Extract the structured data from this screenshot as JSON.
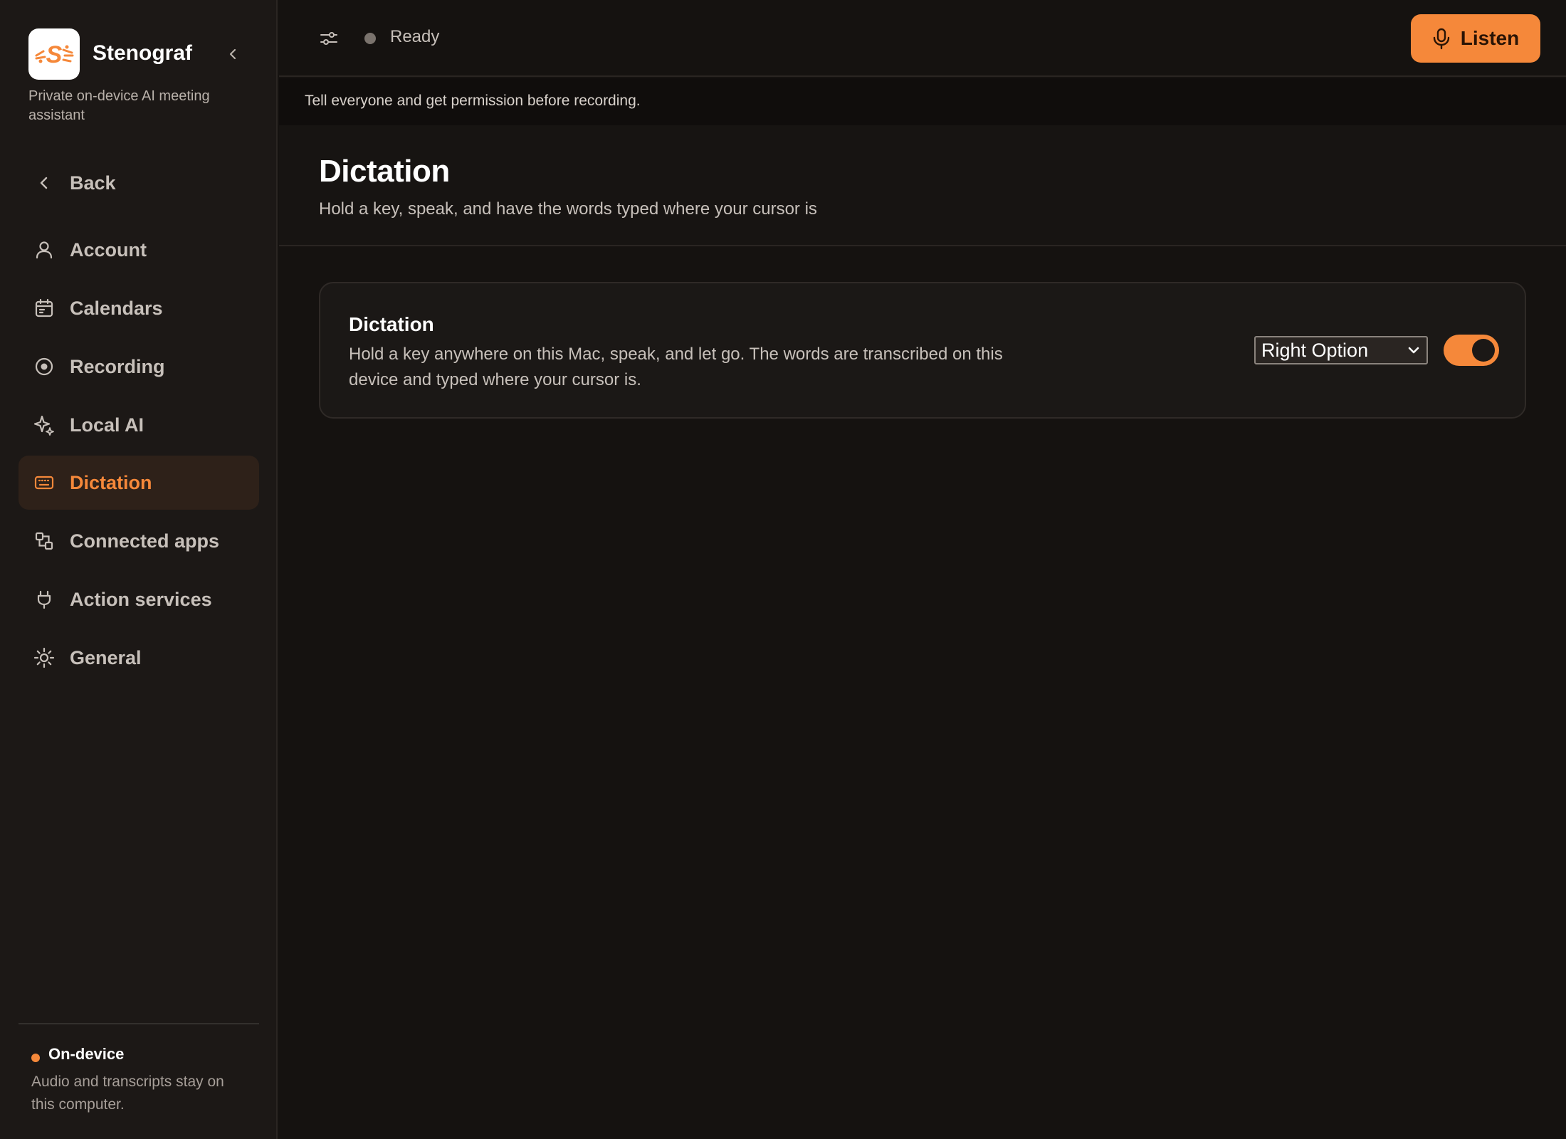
{
  "app": {
    "name": "Stenograf",
    "tagline": "Private on-device AI meeting assistant"
  },
  "sidebar": {
    "back_label": "Back",
    "items": [
      {
        "label": "Account",
        "icon": "user-icon"
      },
      {
        "label": "Calendars",
        "icon": "calendar-icon"
      },
      {
        "label": "Recording",
        "icon": "record-icon"
      },
      {
        "label": "Local AI",
        "icon": "sparkle-icon"
      },
      {
        "label": "Dictation",
        "icon": "keyboard-icon",
        "active": true
      },
      {
        "label": "Connected apps",
        "icon": "connected-apps-icon"
      },
      {
        "label": "Action services",
        "icon": "plug-icon"
      },
      {
        "label": "General",
        "icon": "sun-icon"
      }
    ],
    "footer": {
      "title": "On-device",
      "description": "Audio and transcripts stay on this computer."
    }
  },
  "topbar": {
    "status": "Ready",
    "listen_label": "Listen"
  },
  "notice": "Tell everyone and get permission before recording.",
  "page": {
    "title": "Dictation",
    "subtitle": "Hold a key, speak, and have the words typed where your cursor is"
  },
  "card": {
    "title": "Dictation",
    "description": "Hold a key anywhere on this Mac, speak, and let go. The words are transcribed on this device and typed where your cursor is.",
    "key_select": "Right Option",
    "enabled": true
  },
  "colors": {
    "accent": "#f5883a",
    "background": "#151210",
    "sidebar": "#1c1816"
  }
}
